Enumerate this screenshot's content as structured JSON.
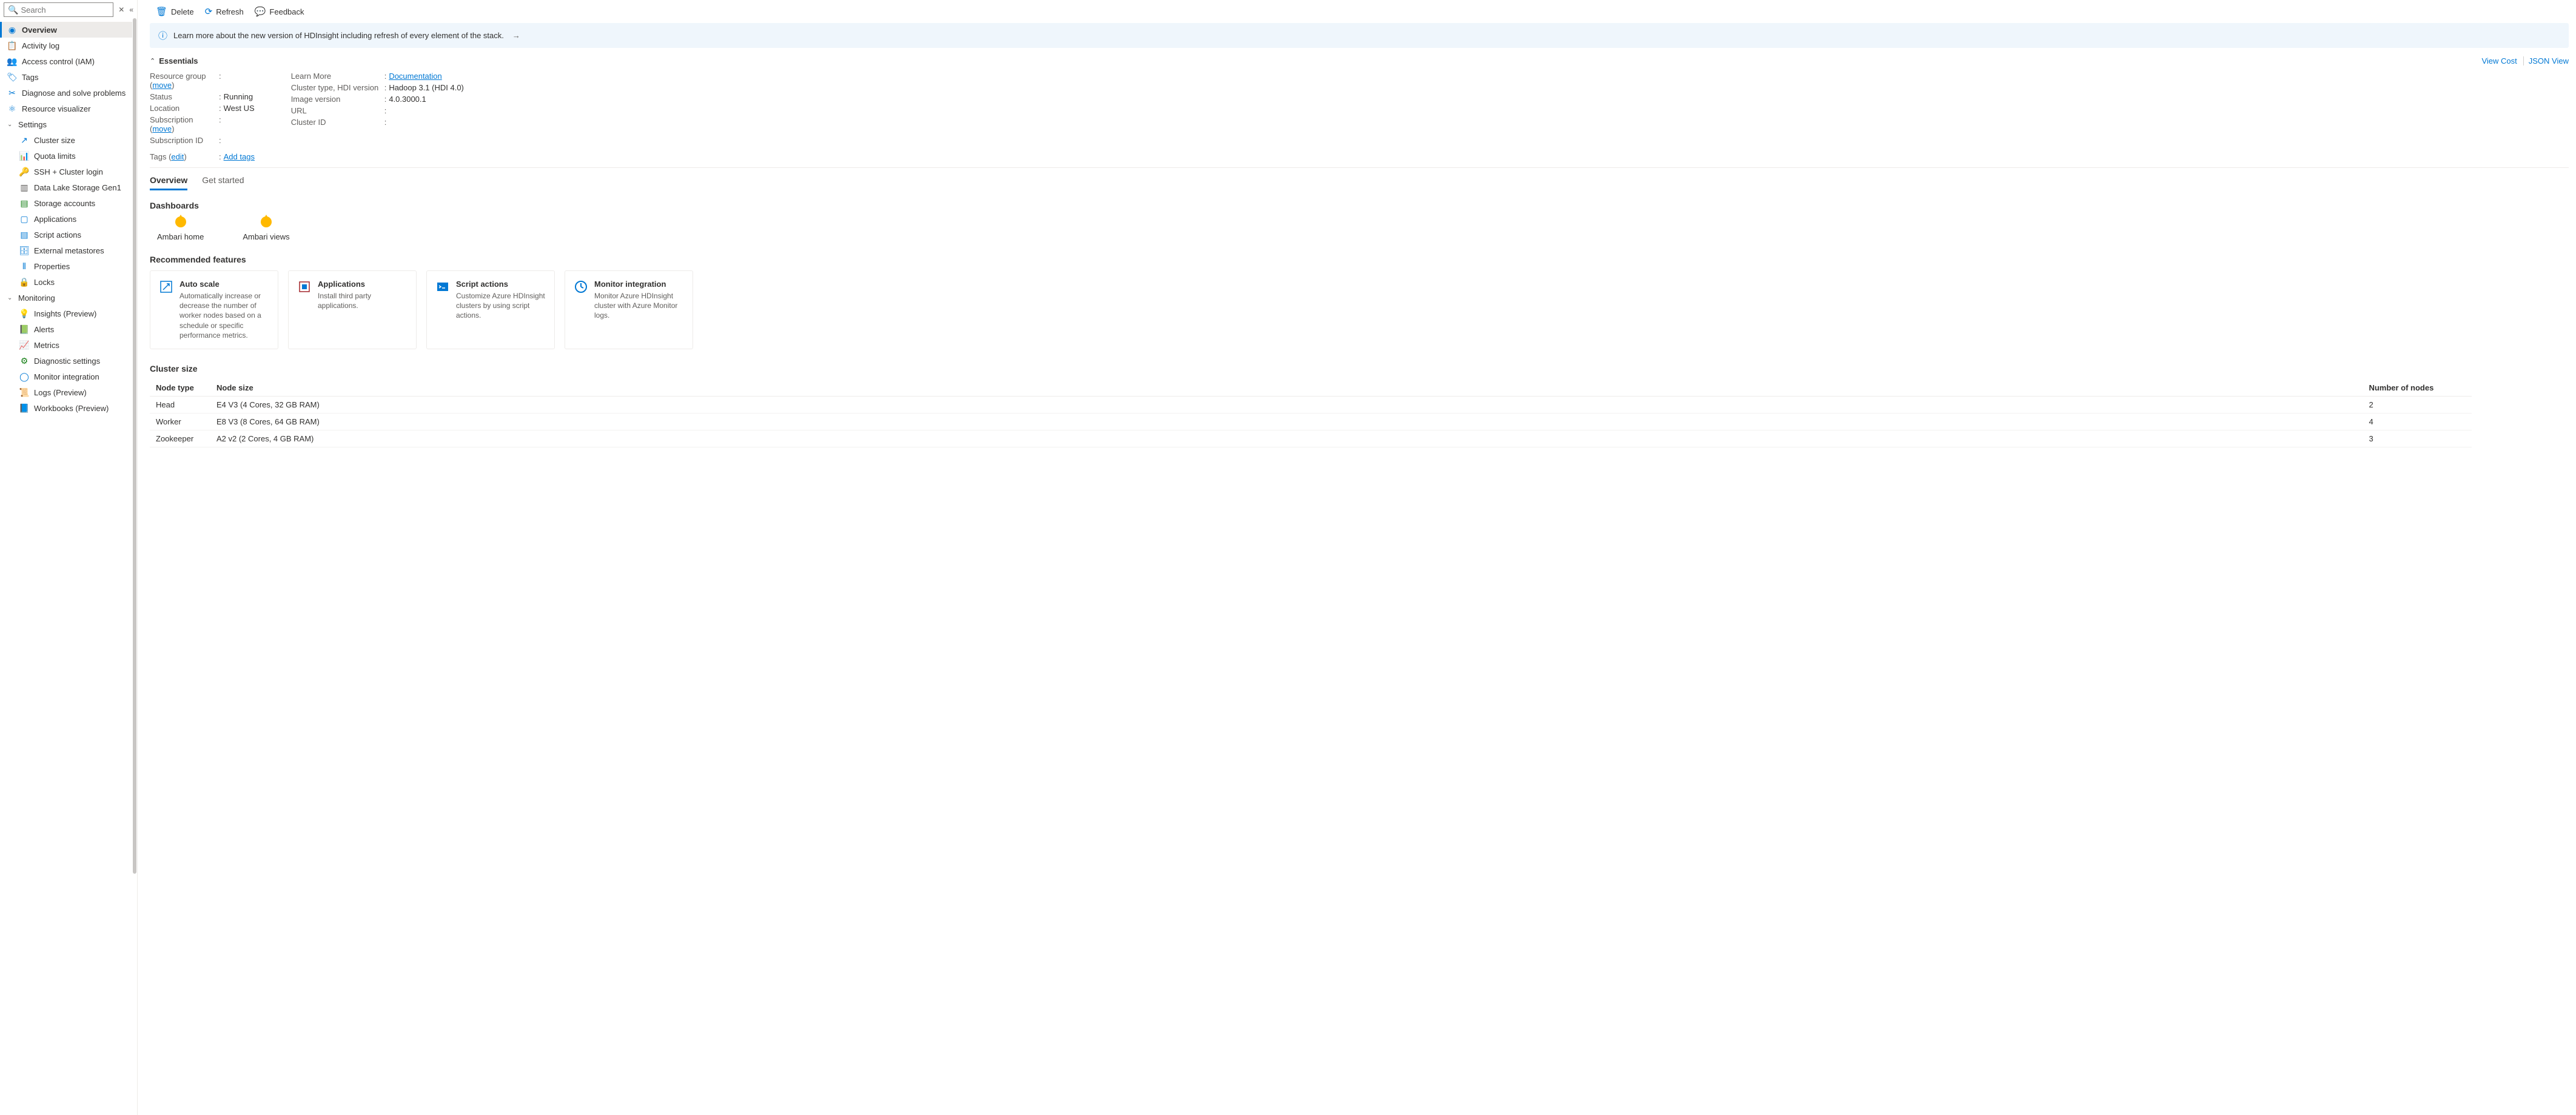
{
  "search": {
    "placeholder": "Search"
  },
  "sidebar": {
    "items": [
      {
        "label": "Overview"
      },
      {
        "label": "Activity log"
      },
      {
        "label": "Access control (IAM)"
      },
      {
        "label": "Tags"
      },
      {
        "label": "Diagnose and solve problems"
      },
      {
        "label": "Resource visualizer"
      }
    ],
    "settings_label": "Settings",
    "settings": [
      {
        "label": "Cluster size"
      },
      {
        "label": "Quota limits"
      },
      {
        "label": "SSH + Cluster login"
      },
      {
        "label": "Data Lake Storage Gen1"
      },
      {
        "label": "Storage accounts"
      },
      {
        "label": "Applications"
      },
      {
        "label": "Script actions"
      },
      {
        "label": "External metastores"
      },
      {
        "label": "Properties"
      },
      {
        "label": "Locks"
      }
    ],
    "monitoring_label": "Monitoring",
    "monitoring": [
      {
        "label": "Insights (Preview)"
      },
      {
        "label": "Alerts"
      },
      {
        "label": "Metrics"
      },
      {
        "label": "Diagnostic settings"
      },
      {
        "label": "Monitor integration"
      },
      {
        "label": "Logs (Preview)"
      },
      {
        "label": "Workbooks (Preview)"
      }
    ]
  },
  "toolbar": {
    "delete": "Delete",
    "refresh": "Refresh",
    "feedback": "Feedback"
  },
  "banner": {
    "text": "Learn more about the new version of HDInsight including refresh of every element of the stack."
  },
  "essentials": {
    "title": "Essentials",
    "view_cost": "View Cost",
    "json_view": "JSON View",
    "left": {
      "resource_group_label": "Resource group",
      "resource_group_move": "move",
      "status_label": "Status",
      "status_value": "Running",
      "location_label": "Location",
      "location_value": "West US",
      "subscription_label": "Subscription",
      "subscription_move": "move",
      "subscription_id_label": "Subscription ID"
    },
    "right": {
      "learn_more_label": "Learn More",
      "learn_more_value": "Documentation",
      "cluster_type_label": "Cluster type, HDI version",
      "cluster_type_value": "Hadoop 3.1 (HDI 4.0)",
      "image_version_label": "Image version",
      "image_version_value": "4.0.3000.1",
      "url_label": "URL",
      "cluster_id_label": "Cluster ID"
    },
    "tags_label": "Tags",
    "tags_edit": "edit",
    "tags_add": "Add tags"
  },
  "tabs": {
    "overview": "Overview",
    "get_started": "Get started"
  },
  "dashboards": {
    "title": "Dashboards",
    "items": [
      {
        "label": "Ambari home"
      },
      {
        "label": "Ambari views"
      }
    ]
  },
  "recommended": {
    "title": "Recommended features",
    "cards": [
      {
        "title": "Auto scale",
        "desc": "Automatically increase or decrease the number of worker nodes based on a schedule or specific performance metrics."
      },
      {
        "title": "Applications",
        "desc": "Install third party applications."
      },
      {
        "title": "Script actions",
        "desc": "Customize Azure HDInsight clusters by using script actions."
      },
      {
        "title": "Monitor integration",
        "desc": "Monitor Azure HDInsight cluster with Azure Monitor logs."
      }
    ]
  },
  "cluster_size": {
    "title": "Cluster size",
    "headers": {
      "type": "Node type",
      "size": "Node size",
      "num": "Number of nodes"
    },
    "rows": [
      {
        "type": "Head",
        "size": "E4 V3 (4 Cores, 32 GB RAM)",
        "num": "2"
      },
      {
        "type": "Worker",
        "size": "E8 V3 (8 Cores, 64 GB RAM)",
        "num": "4"
      },
      {
        "type": "Zookeeper",
        "size": "A2 v2 (2 Cores, 4 GB RAM)",
        "num": "3"
      }
    ]
  }
}
